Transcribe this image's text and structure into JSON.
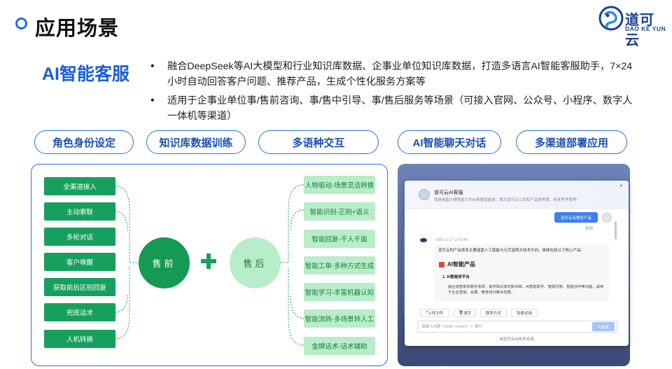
{
  "header": {
    "title": "应用场景",
    "logo": {
      "cn": "道可云",
      "en": "DAO KE YUN"
    }
  },
  "intro": {
    "heading": "AI智能客服",
    "bullets": [
      "融合DeepSeek等AI大模型和行业知识库数据、企事业单位知识库数据，打造多语言AI智能客服助手，7×24小时自动回答客户问题、推荐产品，生成个性化服务方案等",
      "适用于企事业单位事/售前咨询、事/售中引导、事/售后服务等场景（可接入官网、公众号、小程序、数字人一体机等渠道）"
    ]
  },
  "features": [
    "角色身份设定",
    "知识库数据训练",
    "多语种交互",
    "AI智能聊天对话",
    "多渠道部署应用"
  ],
  "diagram": {
    "pre_label": "售前",
    "post_label": "售后",
    "pre_items": [
      "全渠道接入",
      "主动索联",
      "多轮对话",
      "客户唤醒",
      "获取前后区别回复",
      "兜底话术",
      "人机转换"
    ],
    "post_items": [
      "人物驱动-场景灵活转换",
      "智能识别-正则+语义",
      "智能回复-千人千面",
      "智能工单-多种方式生成",
      "智能学习-丰富机器认知",
      "智能流转-多场景转人工",
      "金牌话术-话术辅助"
    ]
  },
  "chat": {
    "title": "道可云AI客服",
    "subtitle": "我是具备大模型能力的AI客服智能体，我对道可云公司和产品很熟悉，快来考考我吧~",
    "user_message": "道可云有哪些产品",
    "copy_label": "复制",
    "time": "2025-11-17 12:01:40",
    "reply_intro": "道可云的产品体系主要涵盖人工智能与元宇宙两大技术方向，具体包括以下核心产品：",
    "reply_heading": "AI智能产品",
    "reply_item": "1. AI智能体平台",
    "reply_desc": "面企级智能体服务系统，提供知识库定制训练、AI智能助手、智能问答、智能创作等功能，适用于企业营销、会展、教育培训等多场景。",
    "actions": [
      "上传文件",
      "清空",
      "联系方式",
      "免费试用"
    ],
    "input_placeholder": "请输入问题（Shift + Enter）＝ 换行",
    "send_label": "发送",
    "footer": "由道可云AI技术支持"
  }
}
